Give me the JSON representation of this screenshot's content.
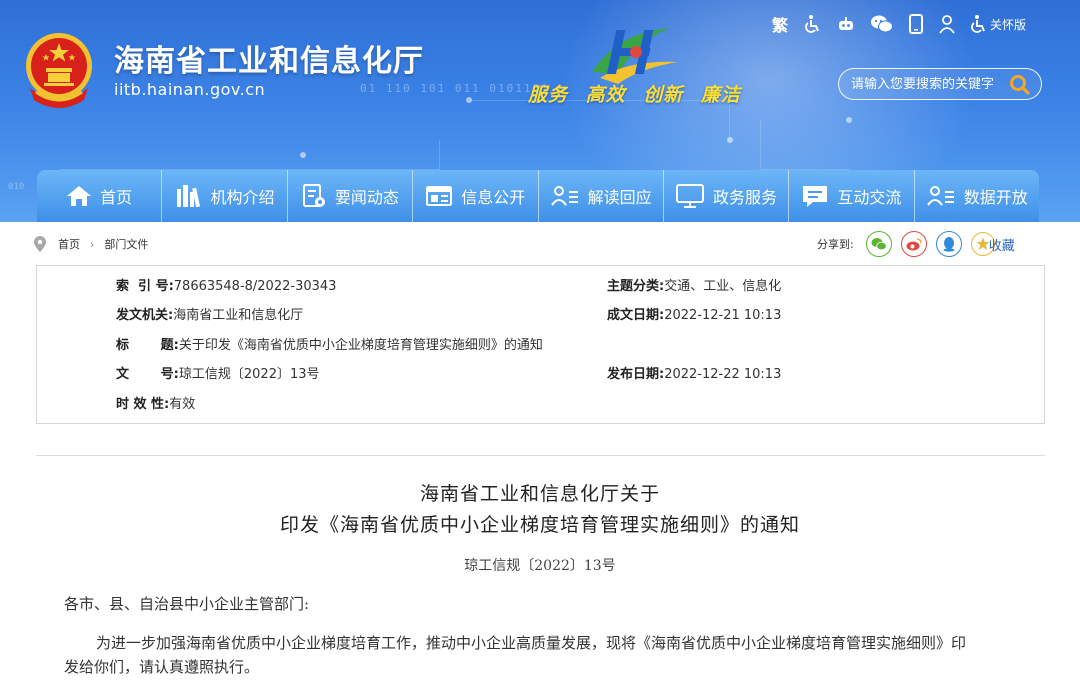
{
  "header": {
    "site_title": "海南省工业和信息化厅",
    "site_url": "iitb.hainan.gov.cn",
    "binary_text": "01 110 101 011 0101101",
    "binary_text_left": "010",
    "slogan": [
      "服务",
      "高效",
      "创新",
      "廉洁"
    ],
    "toolbar": {
      "traditional": "繁",
      "care_mode": "关怀版"
    },
    "search": {
      "placeholder": "请输入您要搜索的关键字"
    }
  },
  "nav": {
    "items": [
      {
        "label": "首页",
        "icon": "home-icon"
      },
      {
        "label": "机构介绍",
        "icon": "books-icon"
      },
      {
        "label": "要闻动态",
        "icon": "news-icon"
      },
      {
        "label": "信息公开",
        "icon": "info-icon"
      },
      {
        "label": "解读回应",
        "icon": "user-list-icon"
      },
      {
        "label": "政务服务",
        "icon": "monitor-icon"
      },
      {
        "label": "互动交流",
        "icon": "chat-icon"
      },
      {
        "label": "数据开放",
        "icon": "data-user-icon"
      }
    ]
  },
  "breadcrumb": {
    "items": [
      "首页",
      "部门文件"
    ],
    "share_label": "分享到:",
    "favorite_label": "收藏"
  },
  "info": {
    "index_label": "索  引 号:",
    "index_value": "78663548-8/2022-30343",
    "topic_label": "主题分类:",
    "topic_value": "交通、工业、信息化",
    "issuer_label": "发文机关:",
    "issuer_value": "海南省工业和信息化厅",
    "date_written_label": "成文日期:",
    "date_written_value": "2022-12-21 10:13",
    "title_label": "标       题:",
    "title_value": "关于印发《海南省优质中小企业梯度培育管理实施细则》的通知",
    "docno_label": "文       号:",
    "docno_value": "琼工信规〔2022〕13号",
    "publish_label": "发布日期:",
    "publish_value": "2022-12-22 10:13",
    "validity_label": "时 效 性:",
    "validity_value": "有效"
  },
  "document": {
    "title_line1": "海南省工业和信息化厅关于",
    "title_line2": "印发《海南省优质中小企业梯度培育管理实施细则》的通知",
    "number": "琼工信规〔2022〕13号",
    "salutation": "各市、县、自治县中小企业主管部门:",
    "body_line1": "为进一步加强海南省优质中小企业梯度培育工作，推动中小企业高质量发展，现将《海南省优质中小企业梯度培育管理实施细则》印",
    "body_line2": "发给你们，请认真遵照执行。"
  },
  "colors": {
    "header_blue": "#3b82e6",
    "nav_blue": "#4a9bf0",
    "slogan_yellow": "#ffdd33",
    "wechat_green": "#5cb531",
    "weibo_red": "#e2473d",
    "qq_blue": "#2f8ad8",
    "star_gold": "#e5b83a"
  }
}
